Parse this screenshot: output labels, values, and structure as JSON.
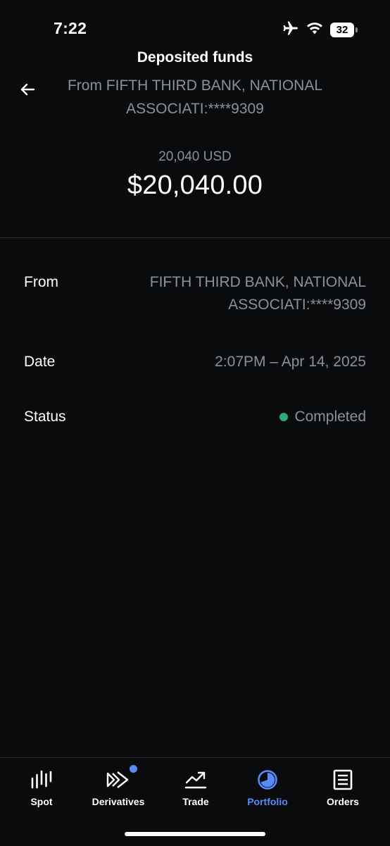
{
  "status_bar": {
    "time": "7:22",
    "battery_level": "32",
    "icons": [
      "airplane-icon",
      "wifi-icon",
      "battery-icon"
    ]
  },
  "header": {
    "title": "Deposited funds",
    "subtitle": "From FIFTH THIRD BANK, NATIONAL ASSOCIATI:****9309"
  },
  "amount": {
    "native": "20,040 USD",
    "fiat": "$20,040.00"
  },
  "details": {
    "from_label": "From",
    "from_value": "FIFTH THIRD BANK, NATIONAL ASSOCIATI:****9309",
    "date_label": "Date",
    "date_value": "2:07PM – Apr 14, 2025",
    "status_label": "Status",
    "status_value": "Completed"
  },
  "tabs": [
    {
      "label": "Spot",
      "icon": "spot-chart-icon",
      "active": false
    },
    {
      "label": "Derivatives",
      "icon": "derivatives-icon",
      "active": false,
      "badge": true
    },
    {
      "label": "Trade",
      "icon": "trade-chart-icon",
      "active": false
    },
    {
      "label": "Portfolio",
      "icon": "portfolio-pie-icon",
      "active": true
    },
    {
      "label": "Orders",
      "icon": "orders-list-icon",
      "active": false
    }
  ],
  "colors": {
    "background": "#0a0b0d",
    "muted_text": "#8a919e",
    "accent": "#578bfa",
    "success": "#27ad75",
    "divider": "#2a2d33"
  }
}
